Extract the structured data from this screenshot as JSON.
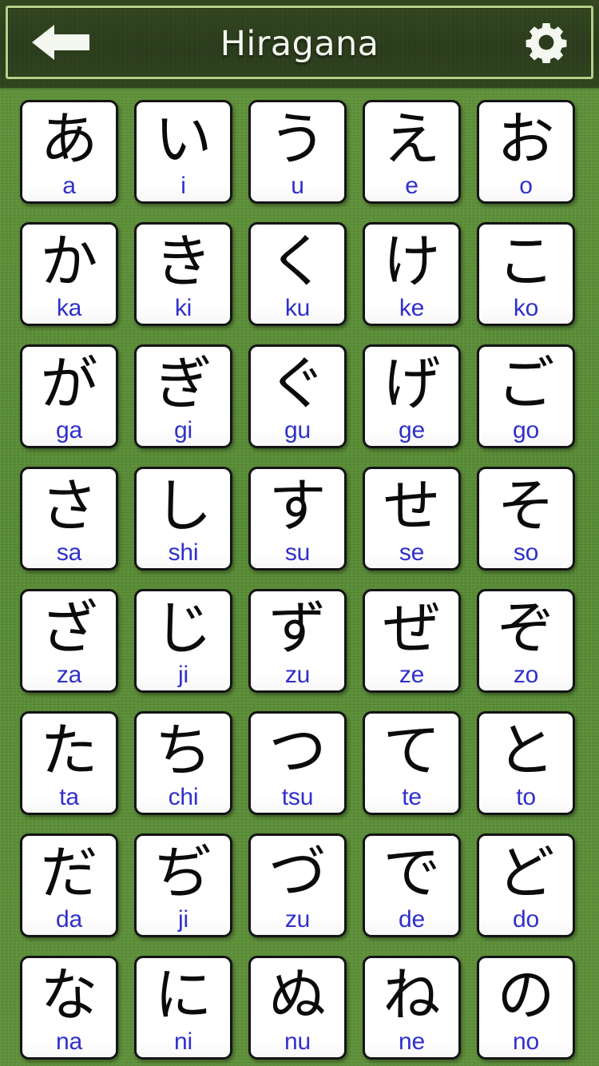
{
  "header": {
    "title": "Hiragana",
    "back_icon": "back-arrow-icon",
    "settings_icon": "gear-icon",
    "background_color": "#2a3c1c",
    "frame_color": "#b6cf86",
    "title_color": "#f3f6ee"
  },
  "theme": {
    "page_background": "#5d8f38",
    "card_background": "#ffffff",
    "card_border": "#141414",
    "kana_color": "#0b0b0b",
    "romaji_color": "#3030cc"
  },
  "grid": {
    "columns": 5,
    "cards": [
      {
        "kana": "あ",
        "romaji": "a"
      },
      {
        "kana": "い",
        "romaji": "i"
      },
      {
        "kana": "う",
        "romaji": "u"
      },
      {
        "kana": "え",
        "romaji": "e"
      },
      {
        "kana": "お",
        "romaji": "o"
      },
      {
        "kana": "か",
        "romaji": "ka"
      },
      {
        "kana": "き",
        "romaji": "ki"
      },
      {
        "kana": "く",
        "romaji": "ku"
      },
      {
        "kana": "け",
        "romaji": "ke"
      },
      {
        "kana": "こ",
        "romaji": "ko"
      },
      {
        "kana": "が",
        "romaji": "ga"
      },
      {
        "kana": "ぎ",
        "romaji": "gi"
      },
      {
        "kana": "ぐ",
        "romaji": "gu"
      },
      {
        "kana": "げ",
        "romaji": "ge"
      },
      {
        "kana": "ご",
        "romaji": "go"
      },
      {
        "kana": "さ",
        "romaji": "sa"
      },
      {
        "kana": "し",
        "romaji": "shi"
      },
      {
        "kana": "す",
        "romaji": "su"
      },
      {
        "kana": "せ",
        "romaji": "se"
      },
      {
        "kana": "そ",
        "romaji": "so"
      },
      {
        "kana": "ざ",
        "romaji": "za"
      },
      {
        "kana": "じ",
        "romaji": "ji"
      },
      {
        "kana": "ず",
        "romaji": "zu"
      },
      {
        "kana": "ぜ",
        "romaji": "ze"
      },
      {
        "kana": "ぞ",
        "romaji": "zo"
      },
      {
        "kana": "た",
        "romaji": "ta"
      },
      {
        "kana": "ち",
        "romaji": "chi"
      },
      {
        "kana": "つ",
        "romaji": "tsu"
      },
      {
        "kana": "て",
        "romaji": "te"
      },
      {
        "kana": "と",
        "romaji": "to"
      },
      {
        "kana": "だ",
        "romaji": "da"
      },
      {
        "kana": "ぢ",
        "romaji": "ji"
      },
      {
        "kana": "づ",
        "romaji": "zu"
      },
      {
        "kana": "で",
        "romaji": "de"
      },
      {
        "kana": "ど",
        "romaji": "do"
      },
      {
        "kana": "な",
        "romaji": "na"
      },
      {
        "kana": "に",
        "romaji": "ni"
      },
      {
        "kana": "ぬ",
        "romaji": "nu"
      },
      {
        "kana": "ね",
        "romaji": "ne"
      },
      {
        "kana": "の",
        "romaji": "no"
      }
    ]
  }
}
